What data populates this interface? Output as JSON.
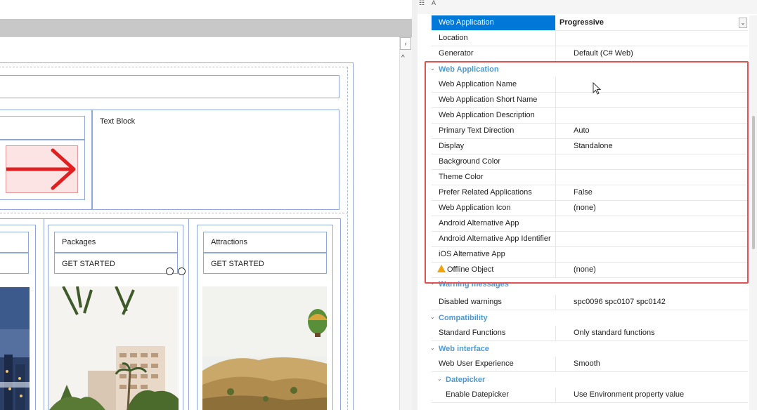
{
  "designer": {
    "text_block_label": "Text Block",
    "cards": [
      {
        "title": "Packages",
        "action": "GET STARTED"
      },
      {
        "title": "Attractions",
        "action": "GET STARTED"
      }
    ]
  },
  "properties": {
    "top_rows": [
      {
        "name": "Web Application",
        "value": "Progressive",
        "selected": true
      },
      {
        "name": "Location",
        "value": ""
      },
      {
        "name": "Generator",
        "value": "Default (C# Web)"
      }
    ],
    "web_application": {
      "category": "Web Application",
      "rows": [
        {
          "name": "Web Application Name",
          "value": ""
        },
        {
          "name": "Web Application Short Name",
          "value": ""
        },
        {
          "name": "Web Application Description",
          "value": ""
        },
        {
          "name": "Primary Text Direction",
          "value": "Auto"
        },
        {
          "name": "Display",
          "value": "Standalone"
        },
        {
          "name": "Background Color",
          "value": ""
        },
        {
          "name": "Theme Color",
          "value": ""
        },
        {
          "name": "Prefer Related Applications",
          "value": "False"
        },
        {
          "name": "Web Application Icon",
          "value": "(none)"
        },
        {
          "name": "Android Alternative App",
          "value": ""
        },
        {
          "name": "Android Alternative App Identifier",
          "value": ""
        },
        {
          "name": "iOS Alternative App",
          "value": ""
        },
        {
          "name": "Offline Object",
          "value": "(none)",
          "warning": true
        }
      ]
    },
    "warning_messages": {
      "category": "Warning messages",
      "rows": [
        {
          "name": "Disabled warnings",
          "value": "spc0096 spc0107 spc0142"
        }
      ]
    },
    "compatibility": {
      "category": "Compatibility",
      "rows": [
        {
          "name": "Standard Functions",
          "value": "Only standard functions"
        }
      ]
    },
    "web_interface": {
      "category": "Web interface",
      "rows": [
        {
          "name": "Web User Experience",
          "value": "Smooth"
        }
      ],
      "datepicker": {
        "category": "Datepicker",
        "rows": [
          {
            "name": "Enable Datepicker",
            "value": "Use Environment property value"
          }
        ]
      }
    }
  },
  "colors": {
    "selection": "#0078d7",
    "category_text": "#4a9ad6",
    "highlight_box": "#e05353",
    "arrow": "#e02020"
  },
  "icons": [
    "categorized-view-icon",
    "alphabetical-sort-icon",
    "dropdown-arrow-icon",
    "collapse-chevron-icon",
    "warning-icon",
    "mouse-pointer-icon"
  ]
}
